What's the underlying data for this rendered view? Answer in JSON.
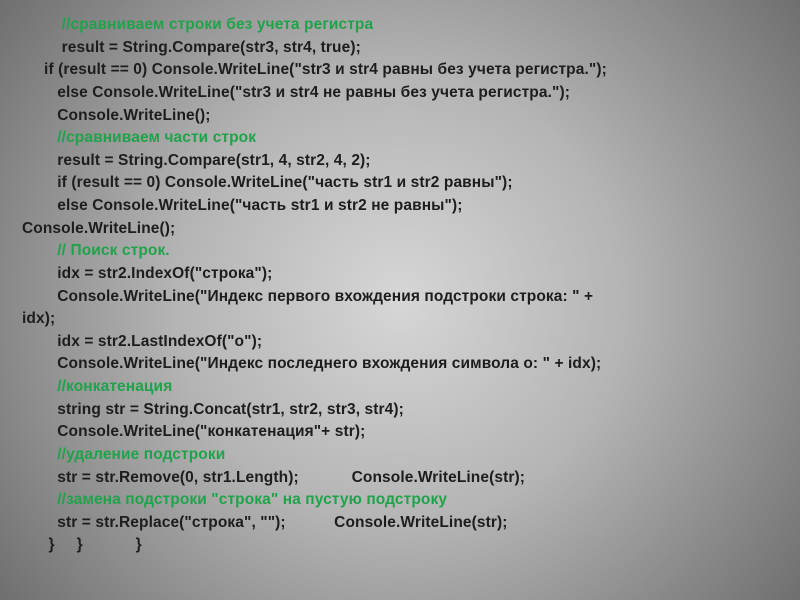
{
  "code": {
    "lines": [
      {
        "indent": "         ",
        "comment": true,
        "text": "//сравниваем строки без учета регистра"
      },
      {
        "indent": "         ",
        "comment": false,
        "text": "result = String.Compare(str3, str4, true);"
      },
      {
        "indent": "     ",
        "comment": false,
        "text": "if (result == 0) Console.WriteLine(\"str3 и str4 равны без учета регистра.\");"
      },
      {
        "indent": "        ",
        "comment": false,
        "text": "else Console.WriteLine(\"str3 и str4 не равны без учета регистра.\");"
      },
      {
        "indent": "        ",
        "comment": false,
        "text": "Console.WriteLine();"
      },
      {
        "indent": "        ",
        "comment": true,
        "text": "//сравниваем части строк"
      },
      {
        "indent": "        ",
        "comment": false,
        "text": "result = String.Compare(str1, 4, str2, 4, 2);"
      },
      {
        "indent": "        ",
        "comment": false,
        "text": "if (result == 0) Console.WriteLine(\"часть str1 и str2 равны\");"
      },
      {
        "indent": "        ",
        "comment": false,
        "text": "else Console.WriteLine(\"часть str1 и str2 не равны\");"
      },
      {
        "indent": "",
        "comment": false,
        "text": "Console.WriteLine();            "
      },
      {
        "indent": "        ",
        "comment": true,
        "text": "// Поиск строк."
      },
      {
        "indent": "        ",
        "comment": false,
        "text": "idx = str2.IndexOf(\"строка\");"
      },
      {
        "indent": "        ",
        "comment": false,
        "text": "Console.WriteLine(\"Индекс первого вхождения подстроки строка: \" + "
      },
      {
        "indent": "",
        "comment": false,
        "text": "idx);"
      },
      {
        "indent": "        ",
        "comment": false,
        "text": "idx = str2.LastIndexOf(\"о\");"
      },
      {
        "indent": "        ",
        "comment": false,
        "text": "Console.WriteLine(\"Индекс последнего вхождения символа о: \" + idx);"
      },
      {
        "indent": "        ",
        "comment": true,
        "text": "//конкатенация"
      },
      {
        "indent": "        ",
        "comment": false,
        "text": "string str = String.Concat(str1, str2, str3, str4);"
      },
      {
        "indent": "        ",
        "comment": false,
        "text": "Console.WriteLine(\"конкатенация\"+ str);"
      },
      {
        "indent": "        ",
        "comment": true,
        "text": "//удаление подстроки"
      },
      {
        "indent": "        ",
        "comment": false,
        "text": "str = str.Remove(0, str1.Length);            Console.WriteLine(str);"
      },
      {
        "indent": "        ",
        "comment": true,
        "text": "//замена подстроки \"строка\" на пустую подстроку"
      },
      {
        "indent": "        ",
        "comment": false,
        "text": "str = str.Replace(\"строка\", \"\");           Console.WriteLine(str);"
      },
      {
        "indent": "      ",
        "comment": false,
        "text": "}     }            }"
      }
    ]
  }
}
